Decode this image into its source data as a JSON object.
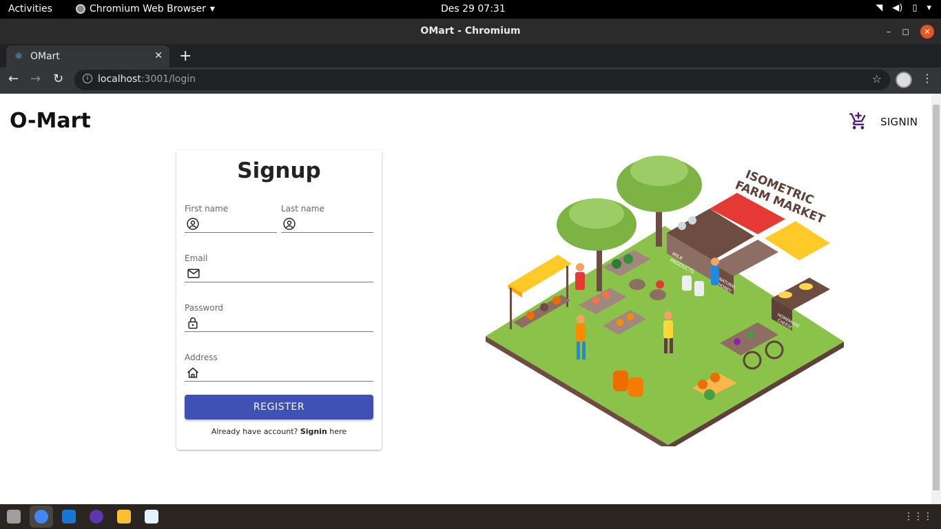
{
  "system": {
    "activities": "Activities",
    "app_name": "Chromium Web Browser",
    "clock": "Des 29  07:31"
  },
  "window": {
    "title": "OMart - Chromium"
  },
  "browser": {
    "tab_title": "OMart",
    "url_host": "localhost",
    "url_rest": ":3001/login"
  },
  "header": {
    "brand": "O-Mart",
    "signin_label": "SIGNIN",
    "cart_icon": "add-shopping-cart-icon"
  },
  "form": {
    "title": "Signup",
    "first_name_label": "First name",
    "last_name_label": "Last name",
    "email_label": "Email",
    "password_label": "Password",
    "address_label": "Address",
    "first_name_value": "",
    "last_name_value": "",
    "email_value": "",
    "password_value": "",
    "address_value": "",
    "register_label": "REGISTER",
    "already_text": "Already have account?",
    "signin_link": "Signin",
    "here_text": "here"
  },
  "illustration": {
    "sign_line1": "ISOMETRIC",
    "sign_line2": "FARM MARKET",
    "stall_milk_1": "MILK",
    "stall_milk_2": "PRODUCTS",
    "stall_honey_1": "NATURAL",
    "stall_honey_2": "HONEY",
    "stall_cheese_1": "HOMEMADE",
    "stall_cheese_2": "CHEESE"
  },
  "colors": {
    "primary": "#3f51b5",
    "cart": "#4a148c",
    "grass": "#8bc34a"
  }
}
